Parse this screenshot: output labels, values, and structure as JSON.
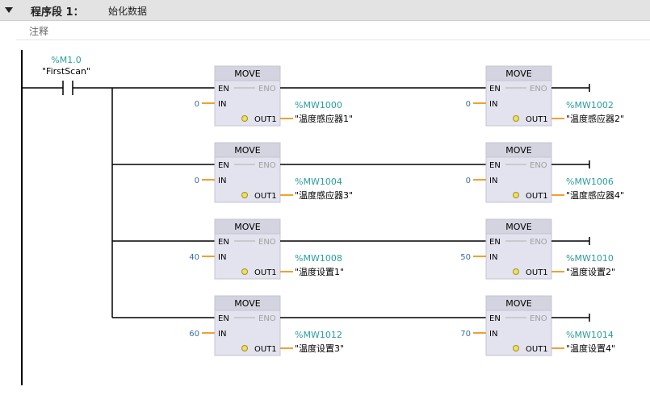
{
  "network": {
    "title": "程序段 1：",
    "subtitle": "始化数据",
    "comment_label": "注释"
  },
  "contact": {
    "address": "%M1.0",
    "symbol": "\"FirstScan\""
  },
  "blocks": [
    {
      "title": "MOVE",
      "en": "EN",
      "eno": "ENO",
      "in_pin": "IN",
      "out_pin": "OUT1",
      "in_value": "0",
      "out_address": "%MW1000",
      "out_symbol": "\"温度感应器1\""
    },
    {
      "title": "MOVE",
      "en": "EN",
      "eno": "ENO",
      "in_pin": "IN",
      "out_pin": "OUT1",
      "in_value": "0",
      "out_address": "%MW1002",
      "out_symbol": "\"温度感应器2\""
    },
    {
      "title": "MOVE",
      "en": "EN",
      "eno": "ENO",
      "in_pin": "IN",
      "out_pin": "OUT1",
      "in_value": "0",
      "out_address": "%MW1004",
      "out_symbol": "\"温度感应器3\""
    },
    {
      "title": "MOVE",
      "en": "EN",
      "eno": "ENO",
      "in_pin": "IN",
      "out_pin": "OUT1",
      "in_value": "0",
      "out_address": "%MW1006",
      "out_symbol": "\"温度感应器4\""
    },
    {
      "title": "MOVE",
      "en": "EN",
      "eno": "ENO",
      "in_pin": "IN",
      "out_pin": "OUT1",
      "in_value": "40",
      "out_address": "%MW1008",
      "out_symbol": "\"温度设置1\""
    },
    {
      "title": "MOVE",
      "en": "EN",
      "eno": "ENO",
      "in_pin": "IN",
      "out_pin": "OUT1",
      "in_value": "50",
      "out_address": "%MW1010",
      "out_symbol": "\"温度设置2\""
    },
    {
      "title": "MOVE",
      "en": "EN",
      "eno": "ENO",
      "in_pin": "IN",
      "out_pin": "OUT1",
      "in_value": "60",
      "out_address": "%MW1012",
      "out_symbol": "\"温度设置3\""
    },
    {
      "title": "MOVE",
      "en": "EN",
      "eno": "ENO",
      "in_pin": "IN",
      "out_pin": "OUT1",
      "in_value": "70",
      "out_address": "%MW1014",
      "out_symbol": "\"温度设置4\""
    }
  ],
  "colors": {
    "operand_address": "#2a9d9d",
    "in_value": "#3a6ea5",
    "pin_line": "#f0a030",
    "block_fill": "#e2e3ee",
    "block_header": "#d3d4e0",
    "rung": "#000000",
    "eno_text": "#a0a0a0"
  }
}
